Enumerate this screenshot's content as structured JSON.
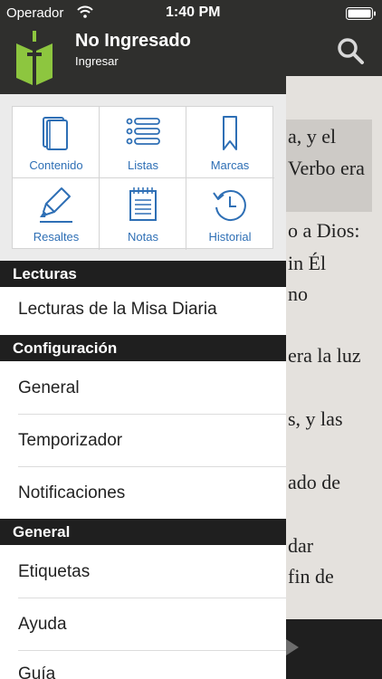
{
  "status_bar": {
    "carrier": "Operador",
    "time": "1:40 PM"
  },
  "profile": {
    "title": "No Ingresado",
    "subtitle": "Ingresar"
  },
  "grid": [
    {
      "label": "Contenido",
      "icon": "book-icon"
    },
    {
      "label": "Listas",
      "icon": "list-icon"
    },
    {
      "label": "Marcas",
      "icon": "bookmark-icon"
    },
    {
      "label": "Resaltes",
      "icon": "highlighter-icon"
    },
    {
      "label": "Notas",
      "icon": "notepad-icon"
    },
    {
      "label": "Historial",
      "icon": "history-icon"
    }
  ],
  "sections": [
    {
      "title": "Lecturas",
      "items": [
        "Lecturas de la Misa Diaria"
      ]
    },
    {
      "title": "Configuración",
      "items": [
        "General",
        "Temporizador",
        "Notificaciones"
      ]
    },
    {
      "title": "General",
      "items": [
        "Etiquetas",
        "Ayuda",
        "Guía"
      ]
    }
  ],
  "reader": {
    "lines": [
      "a, y el",
      "Verbo era",
      "o a Dios:",
      "in Él",
      "no",
      "era la luz",
      "s, y las",
      "ado de",
      "dar",
      "fin de"
    ]
  },
  "colors": {
    "accent": "#2e6fb5",
    "header": "#2f2f2d",
    "section": "#1f1f1f",
    "logo_green": "#8dc63f"
  }
}
